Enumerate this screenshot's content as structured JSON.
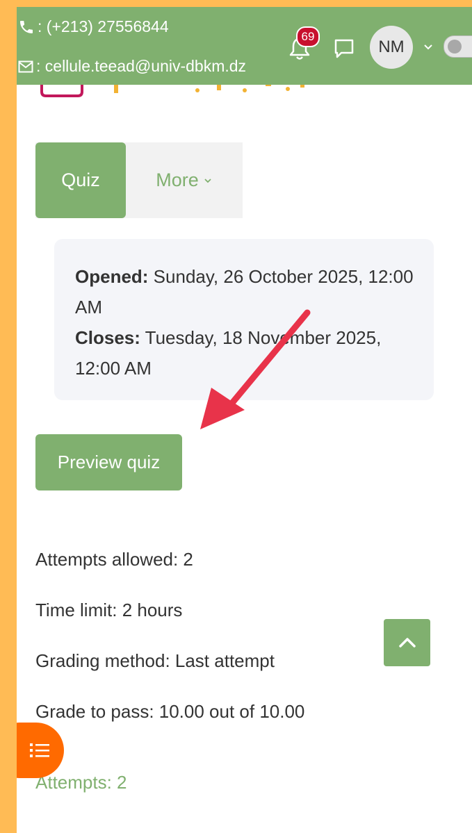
{
  "header": {
    "phone": ": (+213) 27556844",
    "email": ": cellule.teead@univ-dbkm.dz",
    "notification_count": "69",
    "avatar_initials": "NM"
  },
  "tabs": {
    "quiz_label": "Quiz",
    "more_label": "More"
  },
  "dates": {
    "opened_label": "Opened:",
    "opened_value": " Sunday, 26 October 2025, 12:00 AM",
    "closes_label": "Closes:",
    "closes_value": " Tuesday, 18 November 2025, 12:00 AM"
  },
  "actions": {
    "preview_label": "Preview quiz"
  },
  "info": {
    "attempts_allowed": "Attempts allowed: 2",
    "time_limit": "Time limit: 2 hours",
    "grading_method": "Grading method: Last attempt",
    "grade_to_pass": "Grade to pass: 10.00 out of 10.00",
    "attempts_link": "Attempts: 2"
  },
  "icons": {
    "phone": "phone-icon",
    "email": "envelope-icon",
    "notifications": "bell-icon",
    "messages": "chat-bubble-icon",
    "user_menu": "chevron-down-icon",
    "back_to_top": "chevron-up-icon",
    "course_index": "list-icon"
  },
  "colors": {
    "frame": "#ffbb55",
    "brand_green": "#80b06f",
    "badge_red": "#c8102e",
    "index_orange": "#ff6a00",
    "annotation_arrow": "#e8334a"
  }
}
